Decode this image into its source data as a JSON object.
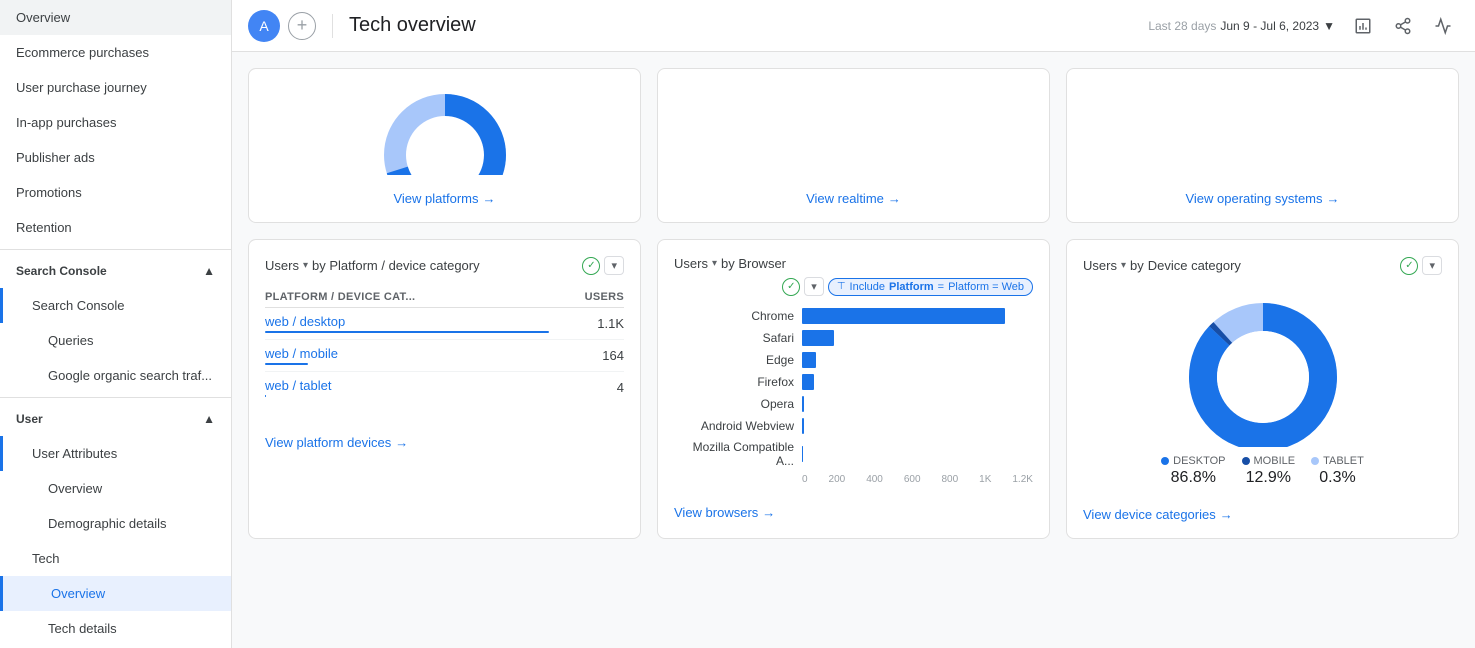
{
  "sidebar": {
    "items": [
      {
        "id": "overview",
        "label": "Overview",
        "level": 0,
        "active": false
      },
      {
        "id": "ecommerce-purchases",
        "label": "Ecommerce purchases",
        "level": 0,
        "active": false
      },
      {
        "id": "user-purchase-journey",
        "label": "User purchase journey",
        "level": 0,
        "active": false
      },
      {
        "id": "in-app-purchases",
        "label": "In-app purchases",
        "level": 0,
        "active": false
      },
      {
        "id": "publisher-ads",
        "label": "Publisher ads",
        "level": 0,
        "active": false
      },
      {
        "id": "promotions",
        "label": "Promotions",
        "level": 0,
        "active": false
      },
      {
        "id": "retention",
        "label": "Retention",
        "level": 0,
        "active": false
      }
    ],
    "search_console_section": "Search Console",
    "search_console_items": [
      {
        "id": "search-console",
        "label": "Search Console",
        "level": 1
      },
      {
        "id": "queries",
        "label": "Queries",
        "level": 2
      },
      {
        "id": "google-organic",
        "label": "Google organic search traf...",
        "level": 2
      }
    ],
    "user_section": "User",
    "user_items": [
      {
        "id": "user-attributes",
        "label": "User Attributes",
        "level": 1
      },
      {
        "id": "user-overview",
        "label": "Overview",
        "level": 2
      },
      {
        "id": "demographic-details",
        "label": "Demographic details",
        "level": 2
      },
      {
        "id": "tech",
        "label": "Tech",
        "level": 1
      },
      {
        "id": "tech-overview",
        "label": "Overview",
        "level": 2,
        "active": true
      },
      {
        "id": "tech-details",
        "label": "Tech details",
        "level": 2
      }
    ]
  },
  "header": {
    "avatar_letter": "A",
    "page_title": "Tech overview",
    "date_label": "Last 28 days",
    "date_range": "Jun 9 - Jul 6, 2023",
    "date_dropdown": "▼"
  },
  "top_cards": [
    {
      "view_link": "View platforms",
      "arrow": "→"
    },
    {
      "view_link": "View realtime",
      "arrow": "→"
    },
    {
      "view_link": "View operating systems",
      "arrow": "→"
    }
  ],
  "platform_card": {
    "title": "Users",
    "by_text": "by Platform / device category",
    "col_platform": "PLATFORM / DEVICE CAT...",
    "col_users": "USERS",
    "rows": [
      {
        "platform": "web / desktop",
        "users": "1.1K",
        "bar_pct": 100
      },
      {
        "platform": "web / mobile",
        "users": "164",
        "bar_pct": 15
      },
      {
        "platform": "web / tablet",
        "users": "4",
        "bar_pct": 0.5
      }
    ],
    "view_link": "View platform devices",
    "arrow": "→"
  },
  "browser_card": {
    "title": "Users",
    "by_text": "by Browser",
    "filter_label": "Include",
    "filter_value": "Platform = Web",
    "browsers": [
      {
        "name": "Chrome",
        "bar_pct": 88
      },
      {
        "name": "Safari",
        "bar_pct": 14
      },
      {
        "name": "Edge",
        "bar_pct": 6
      },
      {
        "name": "Firefox",
        "bar_pct": 5
      },
      {
        "name": "Opera",
        "bar_pct": 1
      },
      {
        "name": "Android Webview",
        "bar_pct": 1
      },
      {
        "name": "Mozilla Compatible A...",
        "bar_pct": 0.5
      }
    ],
    "axis_labels": [
      "0",
      "200",
      "400",
      "600",
      "800",
      "1K",
      "1.2K"
    ],
    "view_link": "View browsers",
    "arrow": "→"
  },
  "device_card": {
    "title": "Users",
    "by_text": "by",
    "by_text2": "Device category",
    "donut": {
      "desktop_pct": 86.8,
      "mobile_pct": 12.9,
      "tablet_pct": 0.3,
      "desktop_color": "#1a73e8",
      "mobile_color": "#174ea6",
      "tablet_color": "#a8c7fa"
    },
    "legend": [
      {
        "label": "DESKTOP",
        "value": "86.8%",
        "color": "#1a73e8"
      },
      {
        "label": "MOBILE",
        "value": "12.9%",
        "color": "#174ea6"
      },
      {
        "label": "TABLET",
        "value": "0.3%",
        "color": "#a8c7fa"
      }
    ],
    "view_link": "View device categories",
    "arrow": "→"
  }
}
